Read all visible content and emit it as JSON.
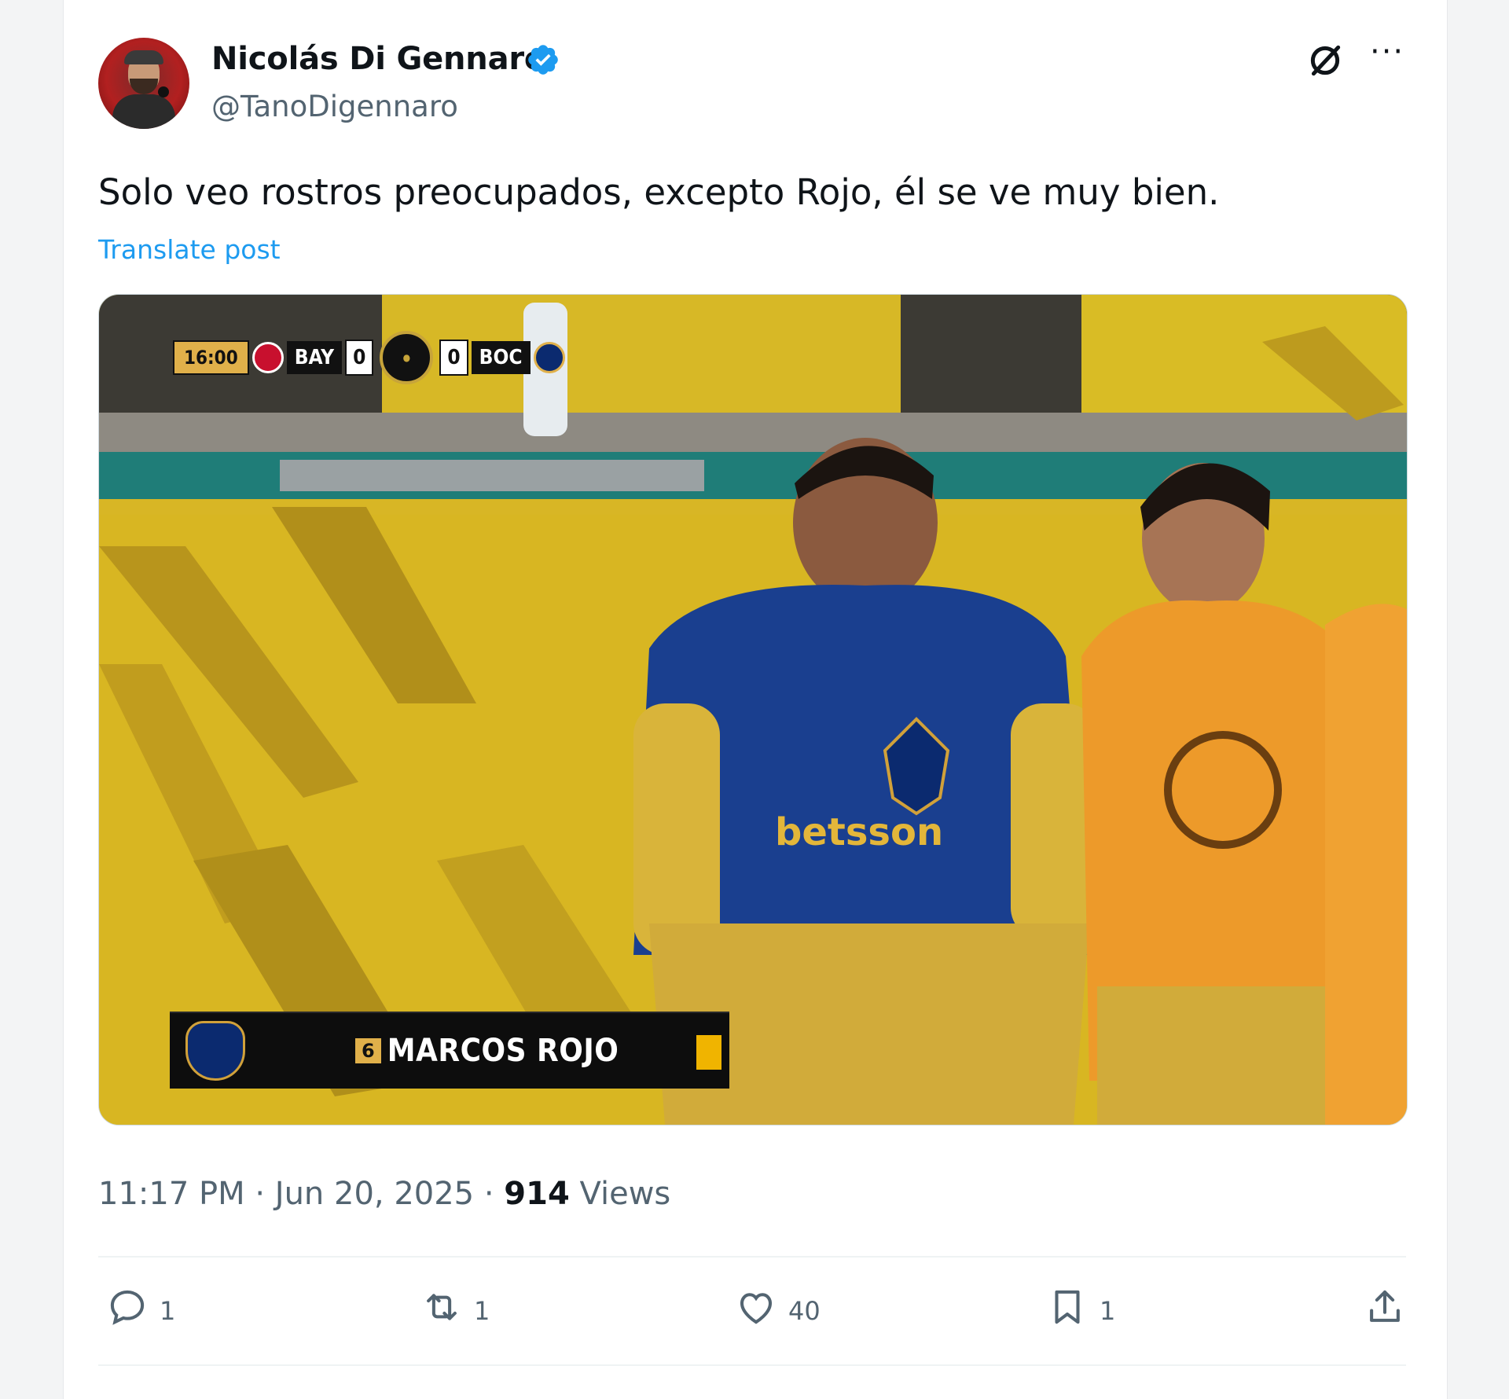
{
  "author": {
    "name": "Nicolás Di Gennaro",
    "handle": "@TanoDigennaro",
    "verified": true
  },
  "post": {
    "text": "Solo veo rostros preocupados, excepto Rojo, él se ve muy bien.",
    "translate_label": "Translate post",
    "time": "11:17 PM",
    "date": "Jun 20, 2025",
    "views_count": "914",
    "views_label": "Views"
  },
  "media": {
    "scorebug": {
      "clock": "16:00",
      "home_team": "BAY",
      "home_score": "0",
      "away_score": "0",
      "away_team": "BOC"
    },
    "lower_third": {
      "number": "6",
      "player_name": "MARCOS ROJO"
    }
  },
  "actions": {
    "replies": "1",
    "reposts": "1",
    "likes": "40",
    "bookmarks": "1"
  },
  "icons": {
    "header": [
      "grok-icon",
      "more-icon",
      "verified-badge-icon"
    ],
    "actions": [
      "reply-icon",
      "repost-icon",
      "like-icon",
      "bookmark-icon",
      "share-icon"
    ]
  },
  "colors": {
    "accent": "#1d9bf0",
    "text_primary": "#0f1419",
    "text_secondary": "#536471"
  }
}
